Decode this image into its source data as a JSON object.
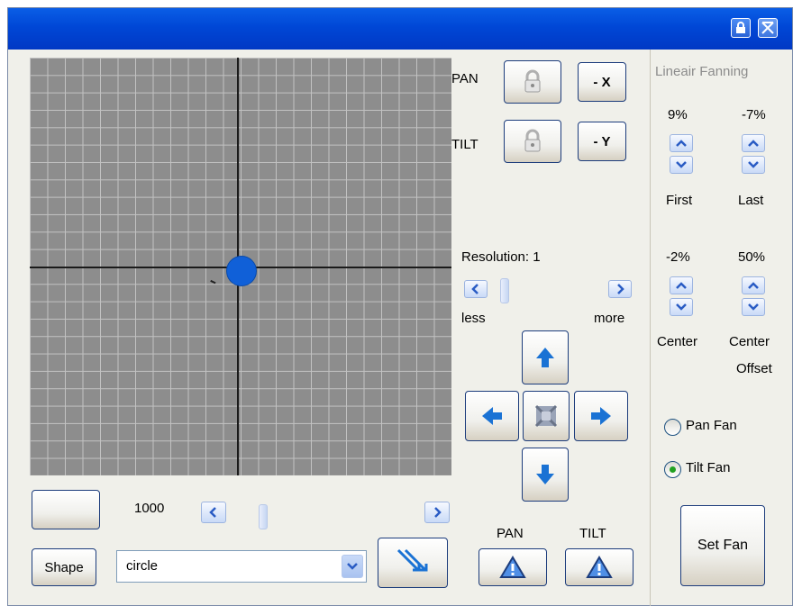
{
  "titlebar": {
    "lock_icon": "lock-icon",
    "close_icon": "close-icon"
  },
  "pan_tilt": {
    "pan_label": "PAN",
    "tilt_label": "TILT",
    "invert_x_label": "- X",
    "invert_y_label": "- Y",
    "lock_icon": "padlock-icon"
  },
  "resolution": {
    "label": "Resolution: 1",
    "less_label": "less",
    "more_label": "more"
  },
  "bottom": {
    "size_value": "1000",
    "shape_button_label": "Shape",
    "shape_select_value": "circle",
    "pan_label": "PAN",
    "tilt_label": "TILT"
  },
  "fanning": {
    "title": "Lineair Fanning",
    "first_value": "9%",
    "last_value": "-7%",
    "first_label": "First",
    "last_label": "Last",
    "center_value": "-2%",
    "center_offset_value": "50%",
    "center_label": "Center",
    "center_offset_label_1": "Center",
    "center_offset_label_2": "Offset",
    "pan_fan_label": "Pan Fan",
    "tilt_fan_label": "Tilt Fan",
    "selected_fan": "Tilt Fan",
    "set_fan_label": "Set Fan"
  },
  "colors": {
    "titlebar": "#0047d6",
    "grid_bg": "#8d8d8d",
    "position_dot": "#1060d8",
    "arrow": "#1a6fd0"
  }
}
